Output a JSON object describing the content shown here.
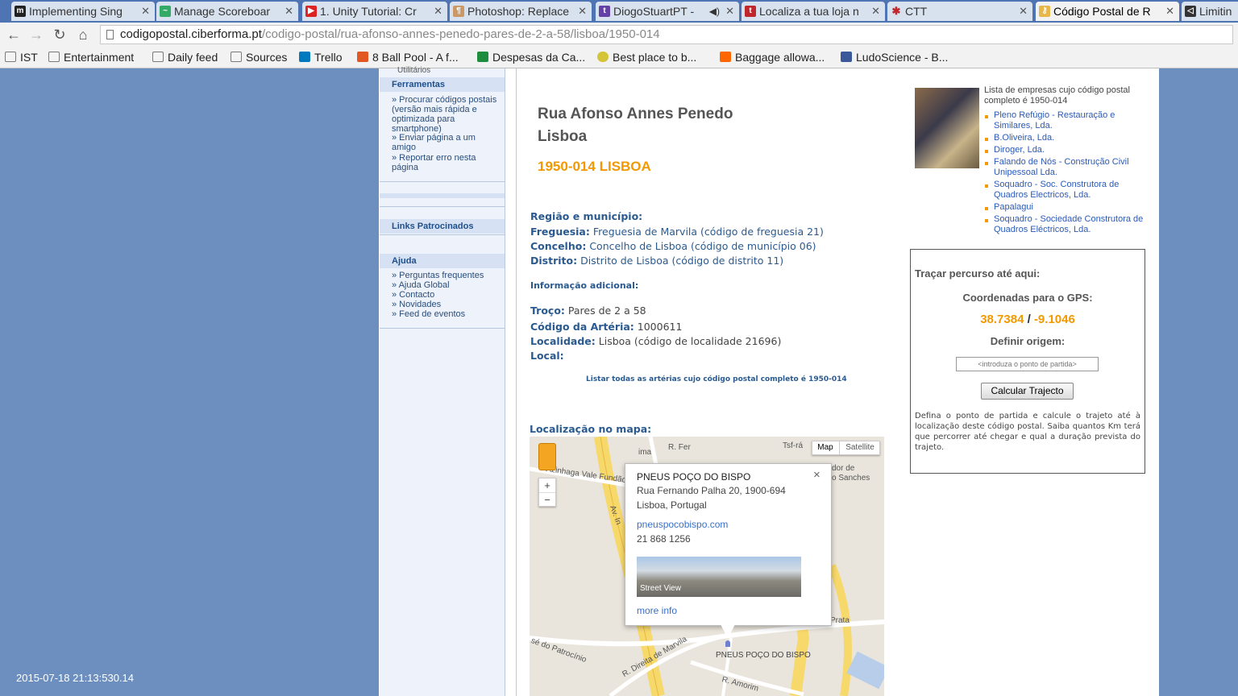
{
  "browser": {
    "tabs": [
      {
        "title": "Implementing Sing",
        "icon": "m-icon",
        "active": false
      },
      {
        "title": "Manage Scoreboar",
        "icon": "chart-icon",
        "active": false
      },
      {
        "title": "1. Unity Tutorial: Cr",
        "icon": "youtube-icon",
        "active": false
      },
      {
        "title": "Photoshop: Replace",
        "icon": "page-icon",
        "active": false
      },
      {
        "title": "DiogoStuartPT -",
        "icon": "twitch-icon",
        "active": false
      },
      {
        "title": "Localiza a tua loja n",
        "icon": "t-icon",
        "active": false
      },
      {
        "title": "CTT",
        "icon": "ctt-icon",
        "active": false
      },
      {
        "title": "Código Postal de R",
        "icon": "key-icon",
        "active": true
      },
      {
        "title": "Limitin",
        "icon": "unity-icon",
        "active": false
      }
    ],
    "url_host": "codigopostal.ciberforma.pt",
    "url_path": "/codigo-postal/rua-afonso-annes-penedo-pares-de-2-a-58/lisboa/1950-014",
    "bookmarks": [
      "IST",
      "Entertainment",
      "Daily feed",
      "Sources",
      "Trello",
      "8 Ball Pool - A f...",
      "Despesas da Ca...",
      "Best place to b...",
      "Baggage allowa...",
      "LudoScience - B..."
    ]
  },
  "sidebar": {
    "partial_top": "Utilitários",
    "ferramentas_title": "Ferramentas",
    "ferramentas_links": [
      "» Procurar códigos postais (versão mais rápida e optimizada para smartphone)",
      "» Enviar página a um amigo",
      "» Reportar erro nesta página"
    ],
    "links_title": "Links Patrocinados",
    "ajuda_title": "Ajuda",
    "ajuda_links": [
      "» Perguntas frequentes",
      "» Ajuda Global",
      "» Contacto",
      "» Novidades",
      "» Feed de eventos"
    ]
  },
  "main": {
    "street_line1": "Rua Afonso Annes Penedo",
    "street_line2": "Lisboa",
    "postal": "1950-014 LISBOA",
    "region_title": "Região e município:",
    "freguesia_label": "Freguesia:",
    "freguesia_value": "Freguesia de Marvila (código de freguesia 21)",
    "concelho_label": "Concelho:",
    "concelho_value": "Concelho de Lisboa (código de município 06)",
    "distrito_label": "Distrito:",
    "distrito_value": "Distrito de Lisboa (código de distrito 11)",
    "info_title": "Informação adicional:",
    "troco_label": "Troço:",
    "troco_value": "Pares de 2 a 58",
    "arteria_label": "Código da Artéria:",
    "arteria_value": "1000611",
    "localidade_label": "Localidade:",
    "localidade_value": "Lisboa (código de localidade 21696)",
    "local_label": "Local:",
    "list_link": "Listar todas as artérias cujo código postal completo é 1950-014",
    "map_title": "Localização no mapa:"
  },
  "map": {
    "type_map": "Map",
    "type_satellite": "Satellite",
    "zoom_in": "+",
    "zoom_out": "−",
    "popup_title": "PNEUS POÇO DO BISPO",
    "popup_addr1": "Rua Fernando Palha 20, 1900-694",
    "popup_addr2": "Lisboa, Portugal",
    "popup_link": "pneuspocobispo.com",
    "popup_phone": "21 868 1256",
    "popup_streetview": "Street View",
    "popup_more": "more info",
    "marker_label": "PNEUS POÇO DO BISPO",
    "street_labels": [
      "Azinhaga Vale Fundão",
      "Av. In",
      "ima",
      "R. Fer",
      "Tsf-rá",
      "dor de",
      "o Sanches",
      "sé do Patrocínio",
      "R. Direita de Marvila",
      "R. Amorim",
      "Prata"
    ]
  },
  "right": {
    "companies_title": "Lista de empresas cujo código postal completo é 1950-014",
    "companies": [
      "Pleno Refúgio - Restauração e Similares, Lda.",
      "B.Oliveira, Lda.",
      "Diroger, Lda.",
      "Falando de Nós - Construção Civil Unipessoal Lda.",
      "Soquadro - Soc. Construtora de Quadros Electricos, Lda.",
      "Papalagui",
      "Soquadro - Sociedade Construtora de Quadros Eléctricos, Lda."
    ],
    "route_title": "Traçar percurso até aqui:",
    "gps_title": "Coordenadas para o GPS:",
    "lat": "38.7384",
    "sep": "/",
    "lon": "-9.1046",
    "origin_title": "Definir origem:",
    "origin_placeholder": "<introduza o ponto de partida>",
    "calc_button": "Calcular Trajecto",
    "desc": "Defina o ponto de partida e calcule o trajeto até à localização deste código postal. Saiba quantos Km terá que percorrer até chegar e qual a duração prevista do trajeto."
  },
  "timestamp": "2015-07-18 21:13:530.14",
  "colors": {
    "accent": "#f39800",
    "link": "#2a5a8f",
    "background": "#6d8fc0"
  }
}
